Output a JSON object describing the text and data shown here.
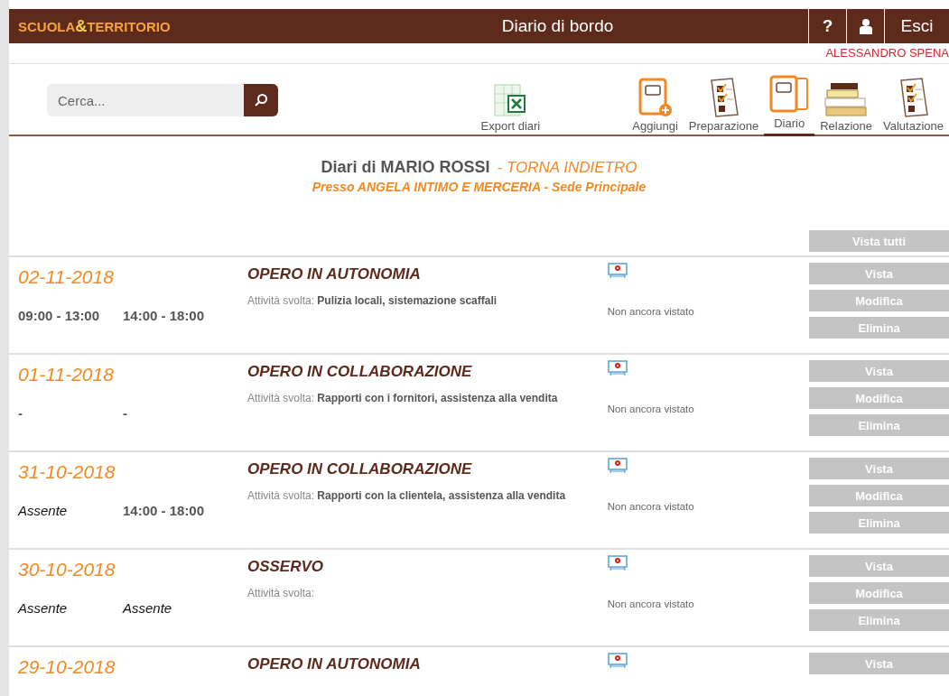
{
  "header": {
    "logo_left": "SCUOLA",
    "logo_amp": "&",
    "logo_right": "TERRITORIO",
    "title": "Diario di bordo",
    "help": "?",
    "logout": "Esci"
  },
  "user": "ALESSANDRO SPENA",
  "search": {
    "placeholder": "Cerca..."
  },
  "toolbar": [
    {
      "label": "Export diari",
      "kind": "excel",
      "selected": false
    },
    {
      "label": "Aggiungi",
      "kind": "add",
      "selected": false
    },
    {
      "label": "Preparazione",
      "kind": "checklist",
      "selected": false
    },
    {
      "label": "Diario",
      "kind": "diary",
      "selected": true
    },
    {
      "label": "Relazione",
      "kind": "books",
      "selected": false
    },
    {
      "label": "Valutazione",
      "kind": "checklist",
      "selected": false
    }
  ],
  "heading": {
    "title": "Diari di MARIO ROSSI",
    "back_link": "- TORNA INDIETRO",
    "subtitle": "Presso ANGELA INTIMO E MERCERIA - Sede Principale"
  },
  "view_all": "Vista tutti",
  "entries": [
    {
      "date": "02-11-2018",
      "title": "OPERO IN AUTONOMIA",
      "slots": [
        {
          "text": "09:00 - 13:00",
          "kind": "time"
        },
        {
          "text": "14:00 - 18:00",
          "kind": "time"
        }
      ],
      "activity_label": "Attività svolta:",
      "activity": "Pulizia locali, sistemazione scaffali",
      "status": "Non ancora vistato",
      "buttons": [
        "Vista",
        "Modifica",
        "Elimina"
      ]
    },
    {
      "date": "01-11-2018",
      "title": "OPERO IN COLLABORAZIONE",
      "slots": [
        {
          "text": "-",
          "kind": "time"
        },
        {
          "text": "-",
          "kind": "time"
        }
      ],
      "activity_label": "Attività svolta:",
      "activity": "Rapporti con i fornitori, assistenza alla vendita",
      "status": "Non ancora vistato",
      "buttons": [
        "Vista",
        "Modifica",
        "Elimina"
      ]
    },
    {
      "date": "31-10-2018",
      "title": "OPERO IN COLLABORAZIONE",
      "slots": [
        {
          "text": "Assente",
          "kind": "absent"
        },
        {
          "text": "14:00 - 18:00",
          "kind": "time"
        }
      ],
      "activity_label": "Attività svolta:",
      "activity": "Rapporti con la clientela, assistenza alla vendita",
      "status": "Non ancora vistato",
      "buttons": [
        "Vista",
        "Modifica",
        "Elimina"
      ]
    },
    {
      "date": "30-10-2018",
      "title": "OSSERVO",
      "slots": [
        {
          "text": "Assente",
          "kind": "absent"
        },
        {
          "text": "Assente",
          "kind": "absent"
        }
      ],
      "activity_label": "Attività svolta:",
      "status": "Non ancora vistato",
      "buttons": [
        "Vista",
        "Modifica",
        "Elimina"
      ]
    },
    {
      "date": "29-10-2018",
      "title": "OPERO IN AUTONOMIA",
      "buttons": [
        "Vista"
      ]
    }
  ]
}
